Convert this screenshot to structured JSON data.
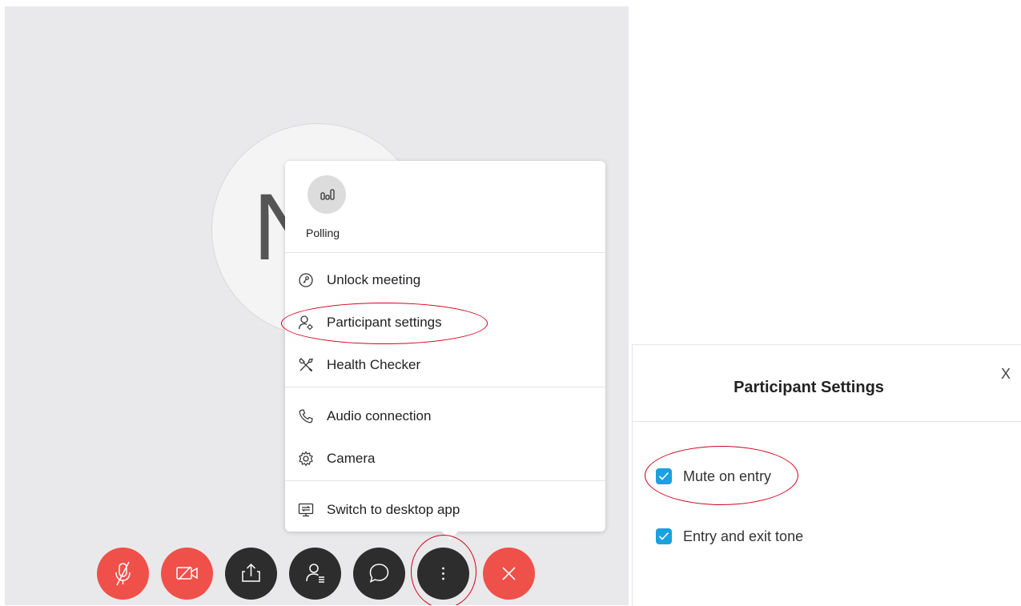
{
  "meeting": {
    "avatar_initial": "N"
  },
  "menu": {
    "polling_label": "Polling",
    "items": [
      {
        "label": "Unlock meeting",
        "icon": "unlock-icon"
      },
      {
        "label": "Participant settings",
        "icon": "participant-settings-icon"
      },
      {
        "label": "Health Checker",
        "icon": "tools-icon"
      },
      {
        "label": "Audio connection",
        "icon": "phone-icon"
      },
      {
        "label": "Camera",
        "icon": "gear-icon"
      },
      {
        "label": "Switch to desktop app",
        "icon": "desktop-switch-icon"
      }
    ]
  },
  "controls": [
    {
      "name": "mute",
      "icon": "microphone-muted-icon",
      "color": "#f0504a"
    },
    {
      "name": "video",
      "icon": "video-off-icon",
      "color": "#f0504a"
    },
    {
      "name": "share",
      "icon": "share-icon",
      "color": "#2d2d2d"
    },
    {
      "name": "participants",
      "icon": "participants-icon",
      "color": "#2d2d2d"
    },
    {
      "name": "chat",
      "icon": "chat-icon",
      "color": "#2d2d2d"
    },
    {
      "name": "more",
      "icon": "more-icon",
      "color": "#2d2d2d"
    },
    {
      "name": "leave",
      "icon": "close-icon",
      "color": "#f0504a"
    }
  ],
  "participant_settings": {
    "title": "Participant Settings",
    "close_label": "X",
    "options": [
      {
        "label": "Mute on entry",
        "checked": true
      },
      {
        "label": "Entry and exit tone",
        "checked": true
      }
    ]
  },
  "colors": {
    "accent": "#1aa1e0",
    "danger": "#f0504a",
    "annotation": "#d0021b"
  }
}
